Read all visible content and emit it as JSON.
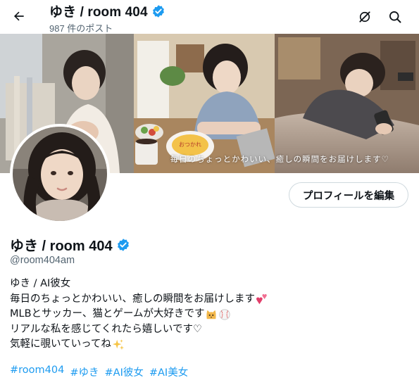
{
  "header": {
    "name": "ゆき / room 404",
    "post_count": "987 件のポスト",
    "back_icon": "arrow-left-icon",
    "grok_icon": "grok-icon",
    "search_icon": "search-icon"
  },
  "banner": {
    "caption": "毎日のちょっとかわいい、癒しの瞬間をお届けします♡",
    "plate_text": "おつかれ"
  },
  "profile": {
    "display_name": "ゆき / room 404",
    "handle": "@room404am",
    "edit_button": "プロフィールを編集",
    "verified_color": "#1d9bf0",
    "bio": [
      "ゆき / AI彼女",
      "毎日のちょっとかわいい、癒しの瞬間をお届けします",
      "MLBとサッカー、猫とゲームが大好きです",
      "リアルな私を感じてくれたら嬉しいです♡",
      "気軽に覗いていってね"
    ],
    "hashtags": [
      "#room404",
      "#ゆき",
      "#AI彼女",
      "#AI美女"
    ]
  },
  "colors": {
    "accent": "#1d9bf0",
    "text": "#0f1419",
    "secondary": "#536471",
    "border": "#cfd9de"
  }
}
